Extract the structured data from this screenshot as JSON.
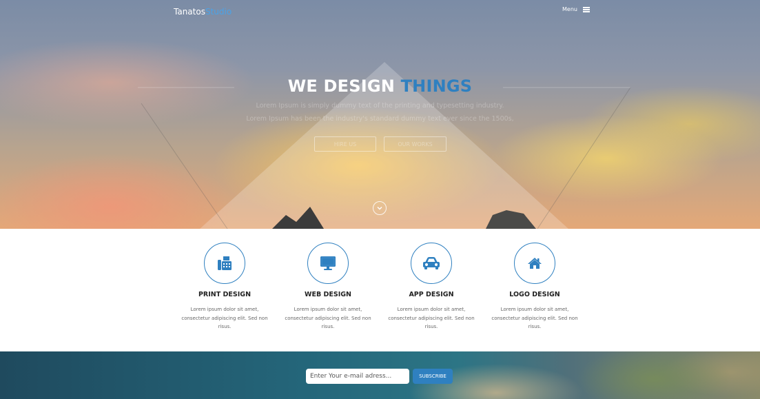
{
  "nav": {
    "logo_main": "Tanatos",
    "logo_accent": "Studio",
    "menu_label": "Menu",
    "menu_icon": "hamburger-icon"
  },
  "hero": {
    "title_main": "WE DESIGN",
    "title_accent": "THINGS",
    "subtitle_line1": "Lorem Ipsum is simply dummy text of the printing and typesetting industry.",
    "subtitle_line2": "Lorem Ipsum has been the industry's standard dummy text ever since the 1500s,",
    "hire_button": "HIRE US",
    "works_button": "OUR WORKS",
    "scroll_icon": "chevron-down-icon"
  },
  "services": [
    {
      "title": "PRINT DESIGN",
      "text": "Lorem ipsum dolor sit amet, consectetur adipiscing elit. Sed non risus.",
      "icon": "fax-icon"
    },
    {
      "title": "WEB DESIGN",
      "text": "Lorem ipsum dolor sit amet, consectetur adipiscing elit. Sed non risus.",
      "icon": "monitor-icon"
    },
    {
      "title": "APP DESIGN",
      "text": "Lorem ipsum dolor sit amet, consectetur adipiscing elit. Sed non risus.",
      "icon": "car-icon"
    },
    {
      "title": "LOGO DESIGN",
      "text": "Lorem ipsum dolor sit amet, consectetur adipiscing elit. Sed non risus.",
      "icon": "home-icon"
    }
  ],
  "subscribe": {
    "placeholder": "Enter Your e-mail adress...",
    "button": "SUBSCRIBE"
  },
  "colors": {
    "accent": "#2f80c0",
    "logo_accent": "#4aa3e8",
    "text_dark": "#222222"
  }
}
